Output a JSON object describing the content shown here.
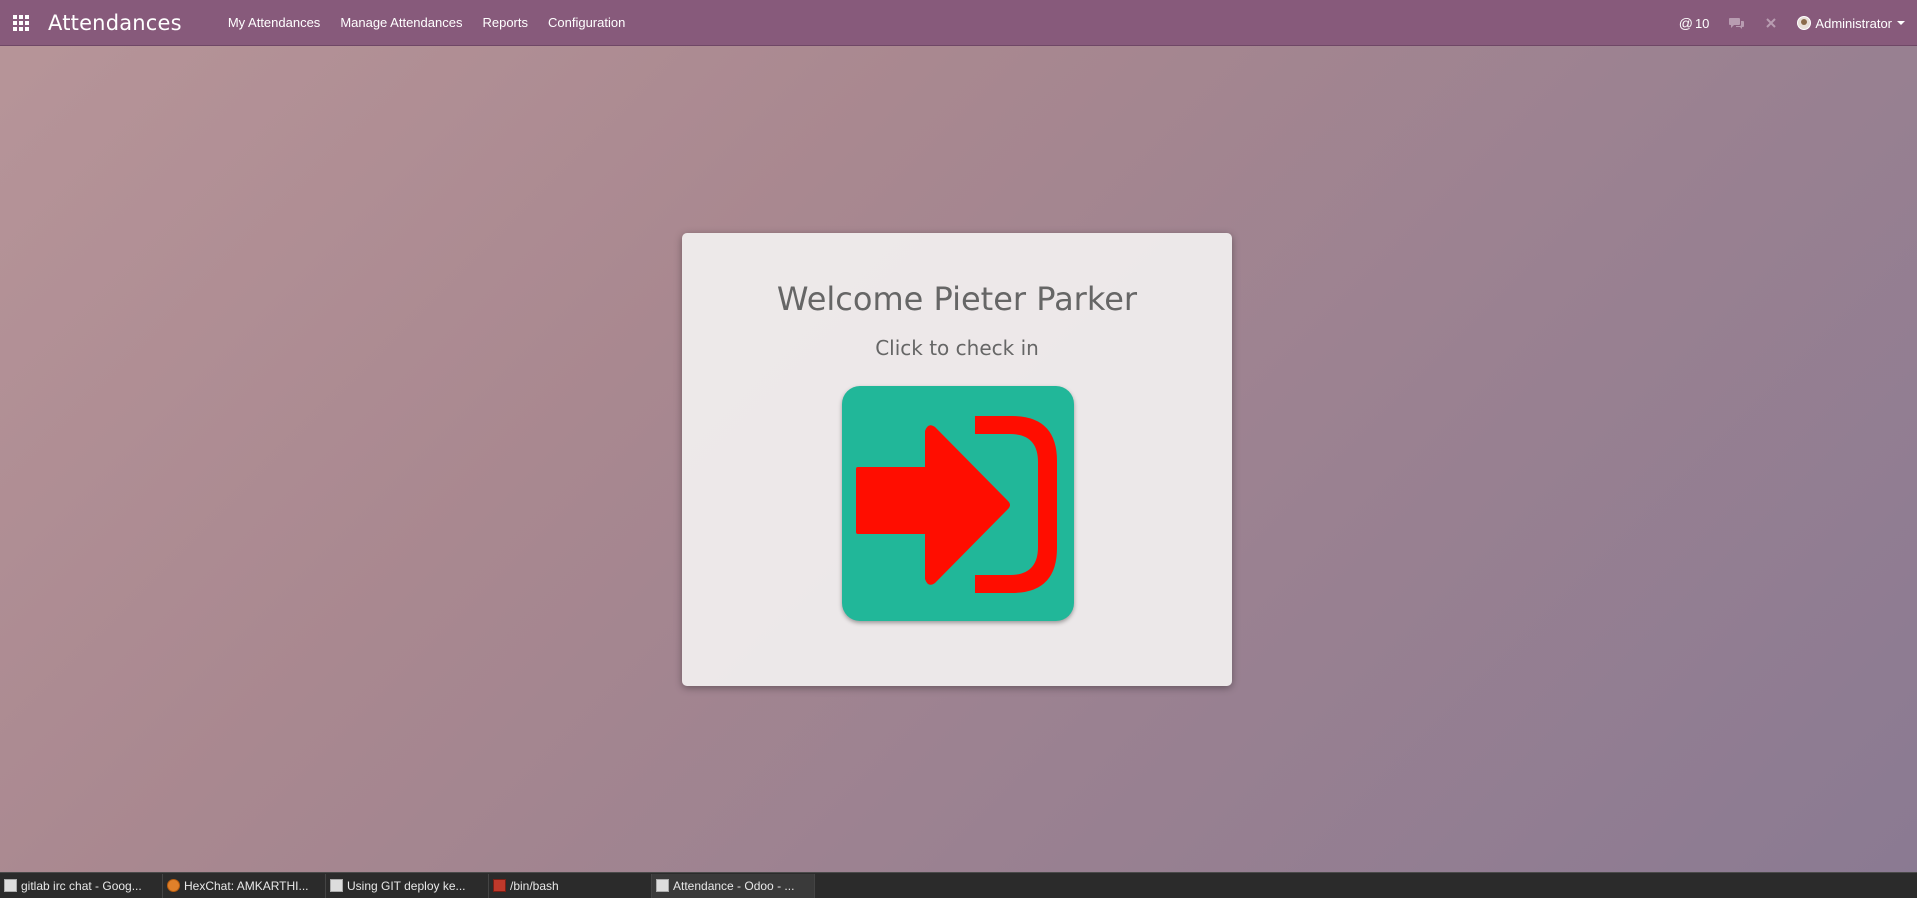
{
  "navbar": {
    "app_title": "Attendances",
    "menu": [
      {
        "label": "My Attendances"
      },
      {
        "label": "Manage Attendances"
      },
      {
        "label": "Reports"
      },
      {
        "label": "Configuration"
      }
    ],
    "systray": {
      "mentions_count": "10",
      "user_name": "Administrator"
    }
  },
  "card": {
    "welcome": "Welcome Pieter Parker",
    "subtitle": "Click to check in",
    "button_icon": "sign-in-icon",
    "button_bg_color": "#21b799",
    "icon_color": "#ff0d00"
  },
  "taskbar": {
    "tasks": [
      {
        "label": "gitlab irc chat - Goog..."
      },
      {
        "label": "HexChat: AMKARTHI..."
      },
      {
        "label": "Using GIT deploy ke..."
      },
      {
        "label": "/bin/bash"
      },
      {
        "label": "Attendance - Odoo - ..."
      }
    ]
  },
  "colors": {
    "navbar": "#875a7b",
    "accent": "#21b799"
  }
}
